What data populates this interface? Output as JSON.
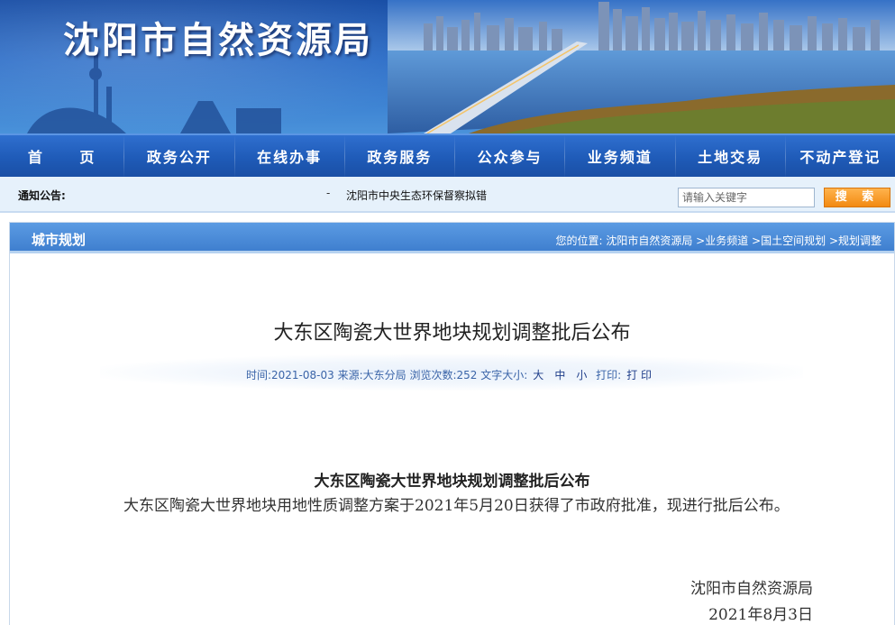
{
  "header": {
    "site_title": "沈阳市自然资源局"
  },
  "nav": {
    "items": [
      {
        "label": "首 页"
      },
      {
        "label": "政务公开"
      },
      {
        "label": "在线办事"
      },
      {
        "label": "政务服务"
      },
      {
        "label": "公众参与"
      },
      {
        "label": "业务频道"
      },
      {
        "label": "土地交易"
      },
      {
        "label": "不动产登记"
      }
    ]
  },
  "notice": {
    "label": "通知公告:",
    "dash": "-",
    "text": "沈阳市中央生态环保督察拟错"
  },
  "search": {
    "placeholder": "请输入关键字",
    "button_label": "搜 索"
  },
  "section": {
    "title": "城市规划",
    "breadcrumb_prefix": "您的位置:",
    "crumbs": [
      "沈阳市自然资源局",
      ">业务频道",
      ">国土空间规划",
      ">规划调整"
    ]
  },
  "article": {
    "title": "大东区陶瓷大世界地块规划调整批后公布",
    "meta": {
      "time_label": "时间:",
      "time": "2021-08-03",
      "source_label": "来源:",
      "source": "大东分局",
      "views_label": "浏览次数:",
      "views": "252",
      "font_size_label": "文字大小:",
      "size_large": "大",
      "size_medium": "中",
      "size_small": "小",
      "print_label": "打印:",
      "print_link": "打 印"
    },
    "doc_heading": "大东区陶瓷大世界地块规划调整批后公布",
    "body": "大东区陶瓷大世界地块用地性质调整方案于2021年5月20日获得了市政府批准，现进行批后公布。",
    "signoff_org": "沈阳市自然资源局",
    "signoff_date": "2021年8月3日"
  },
  "colors": {
    "nav_bg": "#1f5bb8",
    "notice_bg": "#e6f1fb",
    "section_header": "#4a8bd9",
    "search_button": "#f28a12",
    "meta_text": "#3a64a8"
  }
}
